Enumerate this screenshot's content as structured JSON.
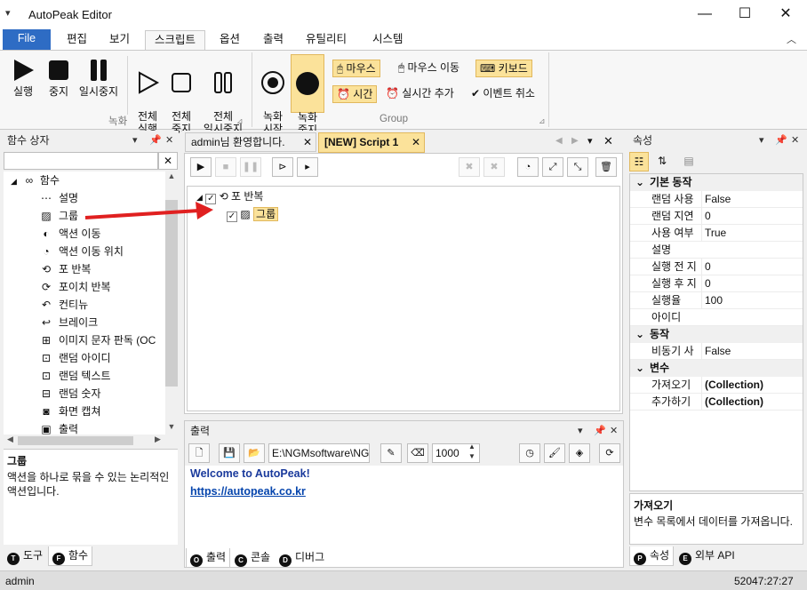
{
  "window": {
    "title": "AutoPeak Editor",
    "quick_access": "▾",
    "min": "—",
    "max": "☐",
    "close": "✕"
  },
  "ribbon_tabs": [
    "File",
    "편집",
    "보기",
    "스크립트",
    "옵션",
    "출력",
    "유틸리티",
    "시스템"
  ],
  "ribbon_collapse": "︿",
  "ribbon": {
    "record_group": {
      "label": "녹화",
      "buttons": [
        {
          "label": "실행",
          "icon": "play-icon"
        },
        {
          "label": "중지",
          "icon": "stop-icon"
        },
        {
          "label": "일시중지",
          "icon": "pause-icon"
        },
        {
          "label": "전체\n실행",
          "icon": "play-outline-icon"
        },
        {
          "label": "전체\n중지",
          "icon": "stop-outline-icon"
        },
        {
          "label": "전체\n일시중지",
          "icon": "pause-outline-icon"
        }
      ]
    },
    "group_group": {
      "label": "Group",
      "buttons": [
        {
          "label": "녹화\n시작",
          "icon": "record-icon"
        },
        {
          "label": "녹화\n중지",
          "icon": "record-stop-icon"
        }
      ],
      "chips": [
        {
          "label": "마우스",
          "icon": "mouse-icon",
          "selected": true
        },
        {
          "label": "마우스 이동",
          "icon": "mouse-move-icon",
          "selected": false
        },
        {
          "label": "키보드",
          "icon": "keyboard-icon",
          "selected": true
        },
        {
          "label": "시간",
          "icon": "clock-icon",
          "selected": true
        },
        {
          "label": "실시간 추가",
          "icon": "alarm-icon",
          "selected": false
        },
        {
          "label": "이벤트 취소",
          "icon": "check-circle-icon",
          "selected": false
        }
      ]
    }
  },
  "left_panel": {
    "title": "함수 상자",
    "search_clear": "✕",
    "root": "함수",
    "items": [
      {
        "label": "설명",
        "icon": "comment-icon"
      },
      {
        "label": "그룹",
        "icon": "group-icon"
      },
      {
        "label": "액션 이동",
        "icon": "action-move-icon"
      },
      {
        "label": "액션 이동 위치",
        "icon": "action-position-icon"
      },
      {
        "label": "포 반복",
        "icon": "for-loop-icon"
      },
      {
        "label": "포이치 반복",
        "icon": "foreach-icon"
      },
      {
        "label": "컨티뉴",
        "icon": "continue-icon"
      },
      {
        "label": "브레이크",
        "icon": "break-icon"
      },
      {
        "label": "이미지 문자 판독 (OC",
        "icon": "ocr-icon"
      },
      {
        "label": "랜덤 아이디",
        "icon": "random-id-icon"
      },
      {
        "label": "랜덤 텍스트",
        "icon": "random-text-icon"
      },
      {
        "label": "랜덤 숫자",
        "icon": "random-number-icon"
      },
      {
        "label": "화면 캡쳐",
        "icon": "camera-icon"
      },
      {
        "label": "출력",
        "icon": "terminal-icon"
      }
    ],
    "desc_title": "그룹",
    "desc_text": "액션을 하나로 묶을 수 있는 논리적인 액션입니다.",
    "bottom_tabs": [
      {
        "letter": "T",
        "label": "도구"
      },
      {
        "letter": "F",
        "label": "함수"
      }
    ]
  },
  "doc_tabs": [
    {
      "label": "admin님 환영합니다.",
      "active": false
    },
    {
      "label": "[NEW] Script 1",
      "active": true
    }
  ],
  "script_tree": {
    "loop_label": "포 반복",
    "group_label": "그룹"
  },
  "output_panel": {
    "title": "출력",
    "path": "E:\\NGMsoftware\\NG",
    "number": "1000",
    "welcome": "Welcome to AutoPeak!",
    "link": "https://autopeak.co.kr",
    "bottom_tabs": [
      {
        "letter": "O",
        "label": "출력"
      },
      {
        "letter": "C",
        "label": "콘솔"
      },
      {
        "letter": "D",
        "label": "디버그"
      }
    ]
  },
  "properties_panel": {
    "title": "속성",
    "categories": [
      {
        "name": "기본 동작",
        "rows": [
          {
            "key": "랜덤 사용",
            "value": "False",
            "bold": false
          },
          {
            "key": "랜덤 지연",
            "value": "0",
            "bold": false
          },
          {
            "key": "사용 여부",
            "value": "True",
            "bold": false
          },
          {
            "key": "설명",
            "value": "",
            "bold": false
          },
          {
            "key": "실행 전 지",
            "value": "0",
            "bold": false
          },
          {
            "key": "실행 후 지",
            "value": "0",
            "bold": false
          },
          {
            "key": "실행율",
            "value": "100",
            "bold": false
          },
          {
            "key": "아이디",
            "value": "",
            "bold": false
          }
        ]
      },
      {
        "name": "동작",
        "rows": [
          {
            "key": "비동기 사",
            "value": "False",
            "bold": false
          }
        ]
      },
      {
        "name": "변수",
        "rows": [
          {
            "key": "가져오기",
            "value": "(Collection)",
            "bold": true
          },
          {
            "key": "추가하기",
            "value": "(Collection)",
            "bold": true
          }
        ]
      }
    ],
    "desc_title": "가져오기",
    "desc_text": "변수 목록에서 데이터를 가져옵니다.",
    "bottom_tabs": [
      {
        "letter": "P",
        "label": "속성"
      },
      {
        "letter": "E",
        "label": "외부 API"
      }
    ]
  },
  "status": {
    "user": "admin",
    "time": "52047:27:27"
  },
  "colors": {
    "file_tab": "#2e6cc4",
    "highlight": "#fbe29a",
    "arrow": "#e02020",
    "link": "#0645ad"
  }
}
